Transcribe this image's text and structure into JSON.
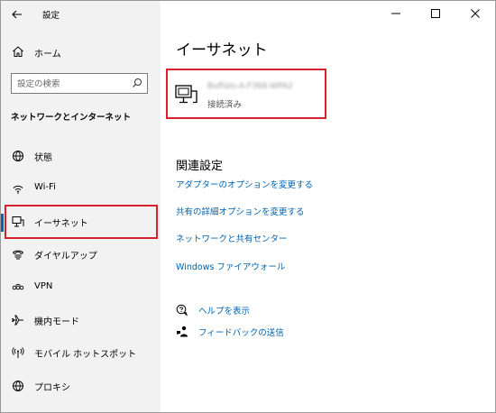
{
  "app": {
    "title": "設定"
  },
  "sidebar": {
    "home_label": "ホーム",
    "search_placeholder": "設定の検索",
    "section_title": "ネットワークとインターネット",
    "items": [
      {
        "label": "状態",
        "icon": "globe-status-icon"
      },
      {
        "label": "Wi-Fi",
        "icon": "wifi-icon"
      },
      {
        "label": "イーサネット",
        "icon": "ethernet-icon",
        "selected": true
      },
      {
        "label": "ダイヤルアップ",
        "icon": "dialup-icon"
      },
      {
        "label": "VPN",
        "icon": "vpn-icon"
      },
      {
        "label": "機内モード",
        "icon": "airplane-icon"
      },
      {
        "label": "モバイル ホットスポット",
        "icon": "hotspot-icon"
      },
      {
        "label": "プロキシ",
        "icon": "globe-proxy-icon"
      }
    ]
  },
  "main": {
    "title": "イーサネット",
    "adapter": {
      "name": "Buffalo-A-F368-WPA2",
      "status": "接続済み"
    },
    "related_heading": "関連設定",
    "links": [
      "アダプターのオプションを変更する",
      "共有の詳細オプションを変更する",
      "ネットワークと共有センター",
      "Windows ファイアウォール"
    ],
    "help": [
      {
        "label": "ヘルプを表示",
        "icon": "help-chat-icon"
      },
      {
        "label": "フィードバックの送信",
        "icon": "feedback-icon"
      }
    ]
  },
  "colors": {
    "accent": "#0063b1",
    "highlight": "#d92030",
    "sidebar_bg": "#f2f2f2"
  }
}
